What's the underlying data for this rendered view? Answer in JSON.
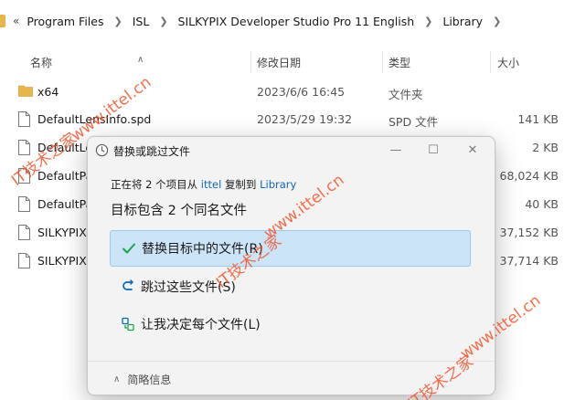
{
  "explorer": {
    "breadcrumb_more": "«",
    "breadcrumb": [
      "Program Files",
      "ISL",
      "SILKYPIX Developer Studio Pro 11 English",
      "Library"
    ],
    "columns": {
      "name": "名称",
      "date": "修改日期",
      "type": "类型",
      "size": "大小"
    },
    "files": [
      {
        "icon": "folder-icon",
        "name": "x64",
        "date": "2023/6/6 16:45",
        "type": "文件夹",
        "size": ""
      },
      {
        "icon": "file-icon",
        "name": "DefaultLensInfo.spd",
        "date": "2023/5/29 19:32",
        "type": "SPD 文件",
        "size": "141 KB"
      },
      {
        "icon": "file-icon",
        "name": "DefaultLe",
        "date": "",
        "type": "",
        "size": "2 KB"
      },
      {
        "icon": "file-icon",
        "name": "DefaultPa",
        "date": "",
        "type": "",
        "size": "68,024 KB"
      },
      {
        "icon": "file-icon",
        "name": "DefaultPa",
        "date": "",
        "type": "",
        "size": "40 KB"
      },
      {
        "icon": "file-icon",
        "name": "SILKYPIX",
        "date": "",
        "type": "",
        "size": "37,152 KB"
      },
      {
        "icon": "file-icon",
        "name": "SILKYPIX",
        "date": "",
        "type": "",
        "size": "37,714 KB"
      }
    ]
  },
  "dialog": {
    "title": "替换或跳过文件",
    "status_prefix": "正在将 2 个项目从",
    "source": "ittel",
    "status_mid": "复制到",
    "destination": "Library",
    "headline": "目标包含 2 个同名文件",
    "options": [
      {
        "icon": "check-icon",
        "label": "替换目标中的文件(R)",
        "selected": true
      },
      {
        "icon": "skip-icon",
        "label": "跳过这些文件(S)",
        "selected": false
      },
      {
        "icon": "decide-icon",
        "label": "让我决定每个文件(L)",
        "selected": false
      }
    ],
    "details_label": "简略信息",
    "window_buttons": {
      "minimize": "—",
      "maximize": "☐",
      "close": "✕"
    }
  },
  "watermarks": {
    "domain": "www.ittel.cn",
    "brand": "IT技术之家"
  },
  "colors": {
    "accent": "#0067c0",
    "link": "#1566b6",
    "selection": "#cce4f7",
    "folder": "#e8b54b",
    "check": "#1aa34a",
    "watermark": "#f2562f"
  }
}
